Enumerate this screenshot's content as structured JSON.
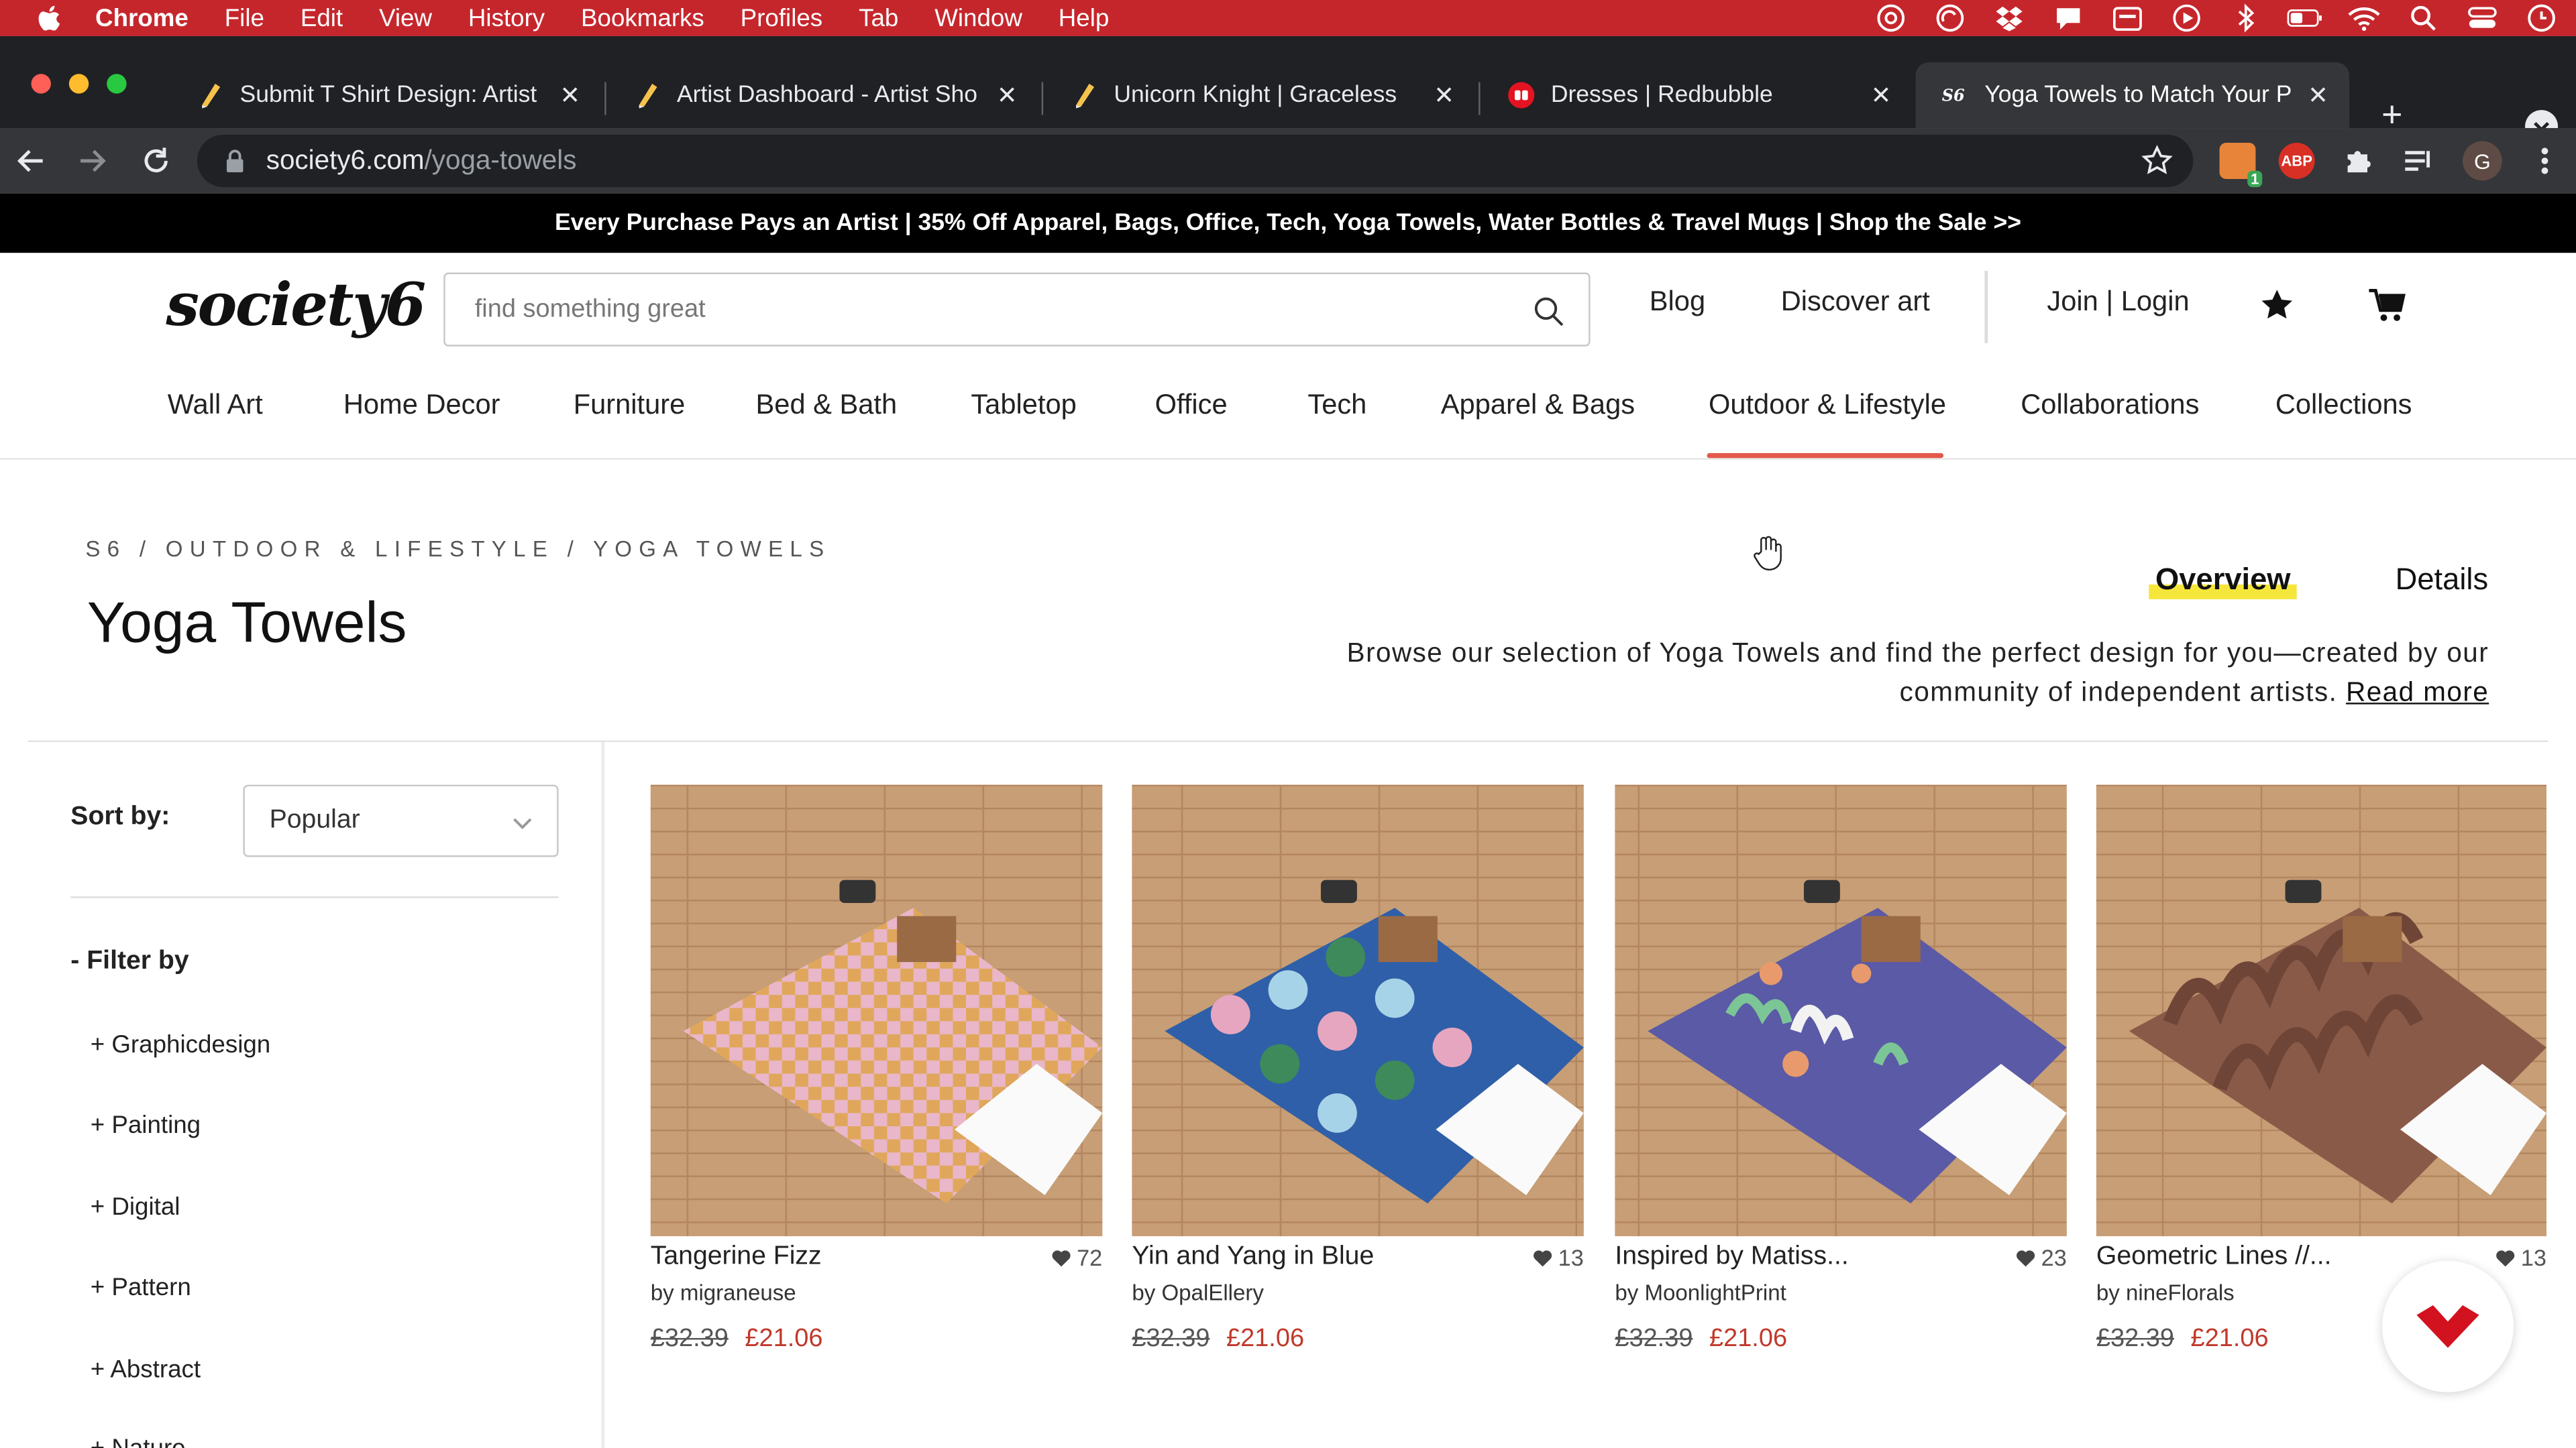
{
  "menubar": {
    "app": "Chrome",
    "items": [
      "File",
      "Edit",
      "View",
      "History",
      "Bookmarks",
      "Profiles",
      "Tab",
      "Window",
      "Help"
    ],
    "status_icons": [
      "creative-cloud-icon",
      "sync-icon",
      "dropbox-icon",
      "notification-icon",
      "calendar-icon",
      "play-icon",
      "bluetooth-icon",
      "battery-icon",
      "wifi-icon",
      "spotlight-icon",
      "control-center-icon",
      "siri-icon"
    ]
  },
  "tabs": [
    {
      "title": "Submit T Shirt Design: Artist",
      "favicon": "pencil-icon"
    },
    {
      "title": "Artist Dashboard - Artist Sho",
      "favicon": "pencil-icon"
    },
    {
      "title": "Unicorn Knight | Graceless",
      "favicon": "pencil-icon"
    },
    {
      "title": "Dresses | Redbubble",
      "favicon": "redbubble-icon"
    },
    {
      "title": "Yoga Towels to Match Your P",
      "favicon": "society6-icon",
      "active": true
    }
  ],
  "toolbar": {
    "url_host": "society6.com",
    "url_path": "/yoga-towels",
    "profile_initial": "G",
    "extensions": [
      "tab-counter-icon",
      "adblock-icon",
      "extensions-icon",
      "reading-list-icon"
    ],
    "ext_badge": "1",
    "abp_label": "ABP"
  },
  "promo": "Every Purchase Pays an Artist | 35% Off Apparel, Bags, Office, Tech, Yoga Towels, Water Bottles & Travel Mugs | Shop the Sale >>",
  "header": {
    "logo": "society6",
    "search_placeholder": "find something great",
    "blog": "Blog",
    "discover": "Discover art",
    "join": "Join | Login"
  },
  "categories": [
    "Wall Art",
    "Home Decor",
    "Furniture",
    "Bed & Bath",
    "Tabletop",
    "Office",
    "Tech",
    "Apparel & Bags",
    "Outdoor & Lifestyle",
    "Collaborations",
    "Collections"
  ],
  "active_category": "Outdoor & Lifestyle",
  "breadcrumb": "S6 / OUTDOOR & LIFESTYLE / YOGA TOWELS",
  "page_title": "Yoga Towels",
  "page_tabs": {
    "overview": "Overview",
    "details": "Details"
  },
  "description": {
    "text": "Browse our selection of Yoga Towels and find the perfect design for you—created by our community of independent artists.",
    "read_more": "Read more"
  },
  "sidebar": {
    "sort_label": "Sort by:",
    "sort_value": "Popular",
    "filter_label": "- Filter by",
    "filters": [
      "+ Graphicdesign",
      "+ Painting",
      "+ Digital",
      "+ Pattern",
      "+ Abstract",
      "+ Nature"
    ]
  },
  "products": [
    {
      "name": "Tangerine Fizz",
      "likes": "72",
      "artist": "by migraneuse",
      "old_price": "£32.39",
      "price": "£21.06"
    },
    {
      "name": "Yin and Yang in Blue",
      "likes": "13",
      "artist": "by OpalEllery",
      "old_price": "£32.39",
      "price": "£21.06"
    },
    {
      "name": "Inspired by Matiss...",
      "likes": "23",
      "artist": "by MoonlightPrint",
      "old_price": "£32.39",
      "price": "£21.06"
    },
    {
      "name": "Geometric Lines //...",
      "likes": "13",
      "artist": "by nineFlorals",
      "old_price": "£32.39",
      "price": "£21.06"
    }
  ],
  "colors": {
    "menubar": "#c5262c",
    "accent_underline": "#e4584c",
    "sale_price": "#c0392b",
    "highlight": "#f5e63c"
  }
}
